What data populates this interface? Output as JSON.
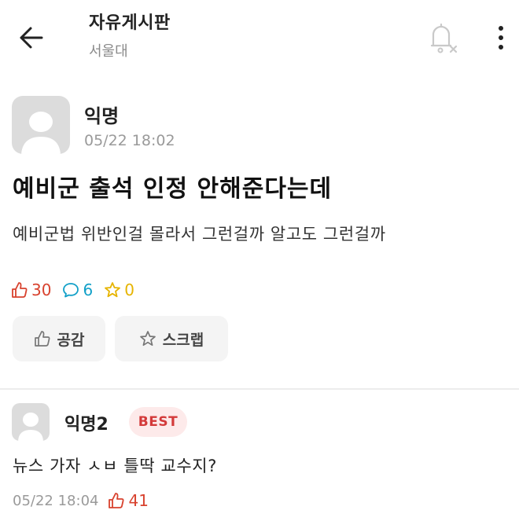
{
  "header": {
    "title": "자유게시판",
    "subtitle": "서울대",
    "icons": {
      "back": "back-arrow-icon",
      "notify": "bell-off-icon",
      "more": "more-vertical-icon"
    }
  },
  "post": {
    "author": "익명",
    "time": "05/22 18:02",
    "title": "예비군 출석 인정 안해준다는데",
    "body": "예비군법 위반인걸 몰라서 그런걸까 알고도 그런걸까",
    "stats": {
      "likes": "30",
      "comments": "6",
      "scraps": "0"
    },
    "actions": {
      "empathy_label": "공감",
      "scrap_label": "스크랩"
    }
  },
  "comment": {
    "author": "익명2",
    "badge": "BEST",
    "text": "뉴스 가자 ㅅㅂ 틀딱 교수지?",
    "time": "05/22 18:04",
    "likes": "41"
  },
  "colors": {
    "like": "#d8422e",
    "comment": "#12a0c8",
    "scrap": "#e6b400",
    "best_bg": "#fdeaea",
    "best_text": "#d33a3a",
    "button_bg": "#f4f4f4"
  }
}
